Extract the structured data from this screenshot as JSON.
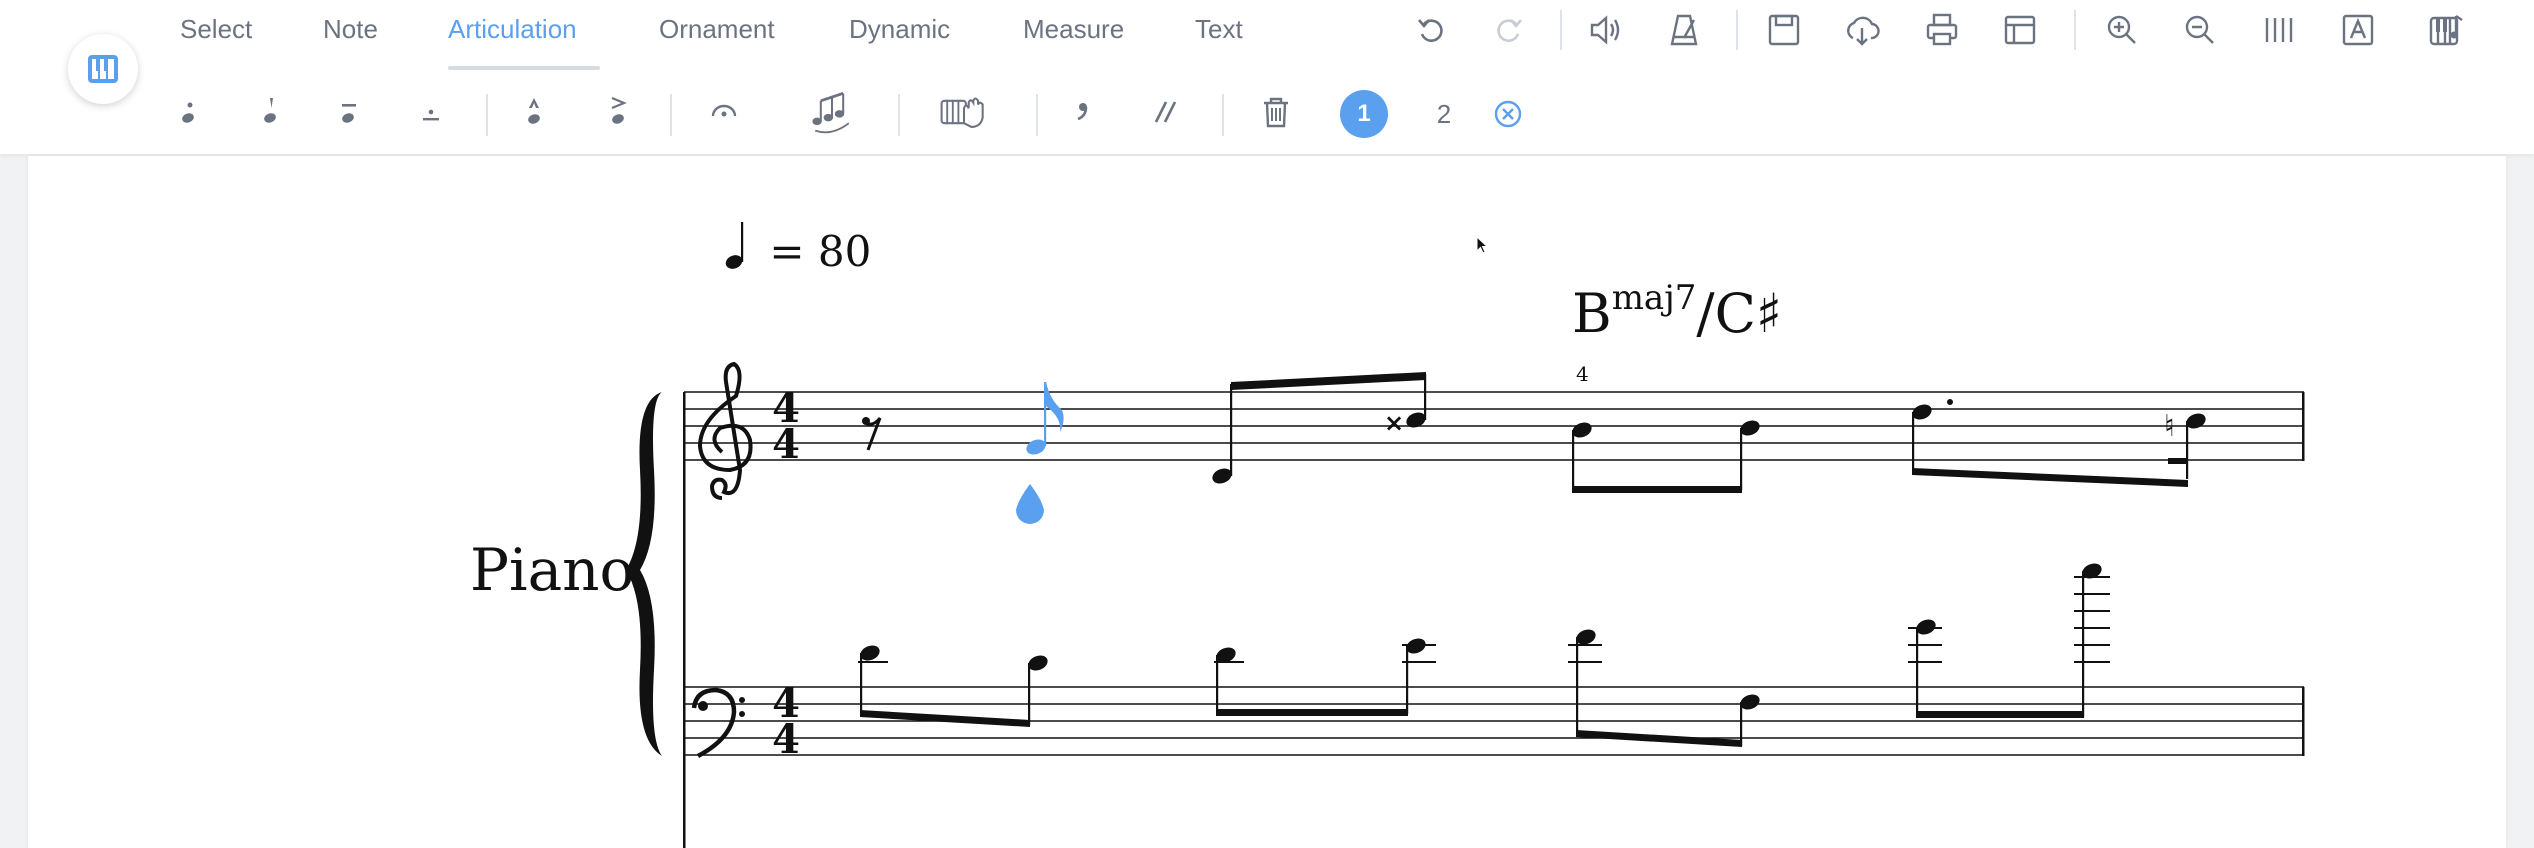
{
  "tabs": [
    {
      "label": "Select",
      "active": false
    },
    {
      "label": "Note",
      "active": false
    },
    {
      "label": "Articulation",
      "active": true
    },
    {
      "label": "Ornament",
      "active": false
    },
    {
      "label": "Dynamic",
      "active": false
    },
    {
      "label": "Measure",
      "active": false
    },
    {
      "label": "Text",
      "active": false
    }
  ],
  "toolbar_right_icons": [
    "undo-icon",
    "redo-icon",
    "volume-icon",
    "metronome-icon",
    "save-icon",
    "download-icon",
    "print-icon",
    "layout-icon",
    "zoom-in-icon",
    "zoom-out-icon",
    "barlines-icon",
    "text-font-icon",
    "instrument-settings-icon"
  ],
  "articulation_icons": [
    "staccato-icon",
    "staccatissimo-icon",
    "tenuto-icon",
    "portato-icon",
    "marcato-icon",
    "accent-icon",
    "fermata-icon",
    "grace-notes-icon",
    "arpeggio-hands-icon",
    "breath-mark-icon",
    "caesura-icon",
    "delete-icon"
  ],
  "voices": {
    "voice1": "1",
    "voice2": "2"
  },
  "colors": {
    "accent": "#5aa0ee",
    "icon": "#6c7380",
    "selected_note": "#5aa0ee"
  },
  "score": {
    "tempo_value": "= 80",
    "chord": {
      "root": "B",
      "quality": "maj7",
      "bass": "/C♯"
    },
    "measure_number": "4",
    "instrument": "Piano",
    "time_signature": {
      "top": "4",
      "bottom": "4"
    }
  }
}
